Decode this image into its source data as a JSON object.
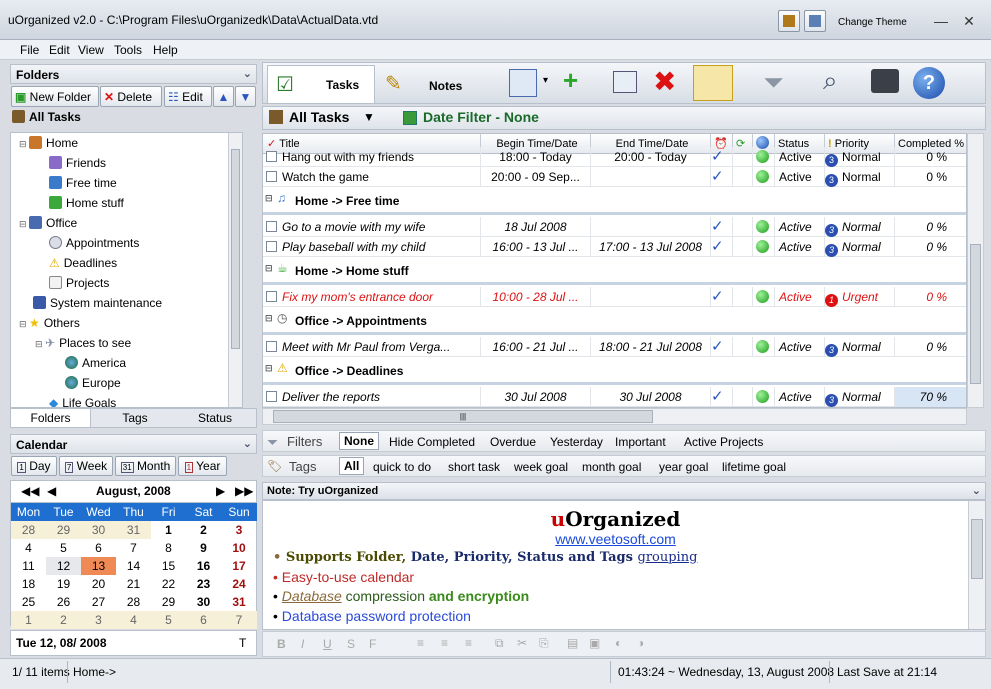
{
  "window": {
    "title": "uOrganized v2.0 - C:\\Program Files\\uOrganizedk\\Data\\ActualData.vtd",
    "change_theme": "Change Theme",
    "minimize": "—",
    "maximize": "☐",
    "close": "✕"
  },
  "menu": [
    "File",
    "Edit",
    "View",
    "Tools",
    "Help"
  ],
  "folders": {
    "header": "Folders",
    "new_folder": "New Folder",
    "delete": "Delete",
    "edit": "Edit",
    "all_tasks": "All Tasks",
    "tree": [
      {
        "label": "Home",
        "icon": "house-icon"
      },
      {
        "label": "Friends",
        "icon": "people-icon"
      },
      {
        "label": "Free time",
        "icon": "music-note-icon"
      },
      {
        "label": "Home stuff",
        "icon": "cup-icon"
      },
      {
        "label": "Office",
        "icon": "office-icon"
      },
      {
        "label": "Appointments",
        "icon": "clock-icon"
      },
      {
        "label": "Deadlines",
        "icon": "warning-icon"
      },
      {
        "label": "Projects",
        "icon": "document-icon"
      },
      {
        "label": "System maintenance",
        "icon": "computer-icon"
      },
      {
        "label": "Others",
        "icon": "star-icon"
      },
      {
        "label": "Places to see",
        "icon": "airplane-icon"
      },
      {
        "label": "America",
        "icon": "globe-icon"
      },
      {
        "label": "Europe",
        "icon": "globe-icon"
      },
      {
        "label": "Life Goals",
        "icon": "diamond-icon"
      }
    ],
    "tabs": [
      "Folders",
      "Tags",
      "Status"
    ]
  },
  "calendar": {
    "header": "Calendar",
    "views": [
      "Day",
      "Week",
      "Month",
      "Year"
    ],
    "view_icons": [
      "1",
      "7",
      "31",
      "1"
    ],
    "month": "August, 2008",
    "weekdays": [
      "Mon",
      "Tue",
      "Wed",
      "Thu",
      "Fri",
      "Sat",
      "Sun"
    ],
    "weeks": [
      [
        "28",
        "29",
        "30",
        "31",
        "1",
        "2",
        "3"
      ],
      [
        "4",
        "5",
        "6",
        "7",
        "8",
        "9",
        "10"
      ],
      [
        "11",
        "12",
        "13",
        "14",
        "15",
        "16",
        "17"
      ],
      [
        "18",
        "19",
        "20",
        "21",
        "22",
        "23",
        "24"
      ],
      [
        "25",
        "26",
        "27",
        "28",
        "29",
        "30",
        "31"
      ],
      [
        "1",
        "2",
        "3",
        "4",
        "5",
        "6",
        "7"
      ]
    ],
    "today": "Tue 12, 08/ 2008",
    "today_btn": "T"
  },
  "toolbar": {
    "tasks": "Tasks",
    "notes": "Notes"
  },
  "taskbar": {
    "all_tasks": "All Tasks",
    "date_filter": "Date Filter - None"
  },
  "grid": {
    "columns": [
      "Title",
      "Begin Time/Date",
      "End Time/Date",
      "Status",
      "Priority",
      "Completed %"
    ],
    "rows_top": [
      {
        "title": "Hang out with my friends",
        "begin": "18:00 - Today",
        "end": "20:00 - Today",
        "status": "Active",
        "priority": "Normal",
        "pri_num": "3",
        "done": "0 %"
      },
      {
        "title": "Watch the game",
        "begin": "20:00 - 09 Sep...",
        "end": "",
        "status": "Active",
        "priority": "Normal",
        "pri_num": "3",
        "done": "0 %"
      }
    ],
    "groups": [
      {
        "label": "Home -> Free time",
        "rows": [
          {
            "title": "Go to a movie with my wife",
            "begin": "18 Jul 2008",
            "end": "",
            "status": "Active",
            "priority": "Normal",
            "pri_num": "3",
            "done": "0 %"
          },
          {
            "title": "Play baseball with my child",
            "begin": "16:00 - 13 Jul ...",
            "end": "17:00 - 13 Jul 2008",
            "status": "Active",
            "priority": "Normal",
            "pri_num": "3",
            "done": "0 %"
          }
        ]
      },
      {
        "label": "Home -> Home stuff",
        "rows": [
          {
            "title": "Fix my mom's entrance door",
            "begin": "10:00 - 28 Jul ...",
            "end": "",
            "status": "Active",
            "priority": "Urgent",
            "pri_num": "1",
            "done": "0 %"
          }
        ]
      },
      {
        "label": "Office -> Appointments",
        "rows": [
          {
            "title": "Meet with Mr Paul from Verga...",
            "begin": "16:00 - 21 Jul ...",
            "end": "18:00 - 21 Jul 2008",
            "status": "Active",
            "priority": "Normal",
            "pri_num": "3",
            "done": "0 %"
          }
        ]
      },
      {
        "label": "Office -> Deadlines",
        "rows": [
          {
            "title": "Deliver the reports",
            "begin": "30 Jul 2008",
            "end": "30 Jul 2008",
            "status": "Active",
            "priority": "Normal",
            "pri_num": "3",
            "done": "70 %"
          }
        ]
      }
    ]
  },
  "filters": {
    "label": "Filters",
    "items": [
      "None",
      "Hide Completed",
      "Overdue",
      "Yesterday",
      "Important",
      "Active Projects"
    ]
  },
  "tags": {
    "label": "Tags",
    "items": [
      "All",
      "quick to do",
      "short task",
      "week goal",
      "month goal",
      "year goal",
      "lifetime goal"
    ]
  },
  "note": {
    "header": "Note: Try uOrganized",
    "brand_u": "u",
    "brand_rest": "Organized",
    "link": "www.veetosoft.com",
    "line1_a": "Supports Folder, ",
    "line1_b": "Date, Priority, Status and Tags ",
    "line1_c": "grouping",
    "line2": "Easy-to-use calendar",
    "line3_a": "Database",
    "line3_b": " compression ",
    "line3_c": "and encryption",
    "line4": "Database password protection"
  },
  "format_bar": [
    "B",
    "I",
    "U",
    "S",
    "F"
  ],
  "status": {
    "items": "1/ 11 items",
    "path": "Home->",
    "clock": "01:43:24  ~  Wednesday, 13, August 2008",
    "last_save": "Last Save at 21:14"
  },
  "colors": {
    "accent": "#1f6fd1",
    "urgent": "#dd1111",
    "today": "#f08a55",
    "selected": "#d7e5f5"
  }
}
